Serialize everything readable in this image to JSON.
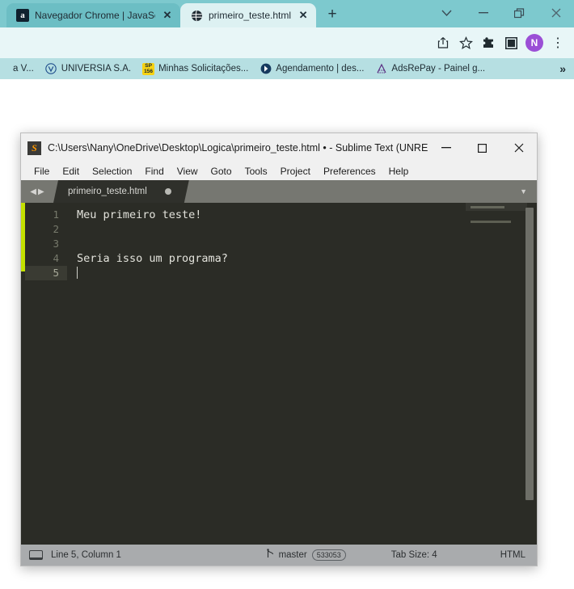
{
  "browser": {
    "tabs": [
      {
        "title": "Navegador Chrome | JavaScr",
        "favicon": "alura-icon",
        "favicon_letter": "a",
        "close": "✕",
        "active": false
      },
      {
        "title": "primeiro_teste.html",
        "favicon": "globe-icon",
        "close": "✕",
        "active": true
      }
    ],
    "new_tab_label": "+",
    "window_controls": {
      "tab_search": "⌄",
      "minimize": "—",
      "restore": "❐",
      "close": "✕"
    },
    "toolbar": {
      "share_icon": "share-icon",
      "bookmark_icon": "star-icon",
      "extensions_icon": "puzzle-icon",
      "side_panel_icon": "side-panel-icon",
      "profile_initial": "N",
      "menu_icon": "⋮"
    },
    "bookmarks": [
      {
        "label": "a V...",
        "icon": "favicon"
      },
      {
        "label": "UNIVERSIA S.A.",
        "icon": "universia-icon",
        "icon_text": "V"
      },
      {
        "label": "Minhas Solicitações...",
        "icon": "sp156-icon",
        "icon_text_top": "SP",
        "icon_text_bottom": "156"
      },
      {
        "label": "Agendamento | des...",
        "icon": "agendamento-icon"
      },
      {
        "label": "AdsRePay - Painel g...",
        "icon": "adsrepay-icon"
      }
    ],
    "bookmarks_overflow": "»"
  },
  "sublime": {
    "window_title": "C:\\Users\\Nany\\OneDrive\\Desktop\\Logica\\primeiro_teste.html • - Sublime Text (UNREGI...",
    "logo_letter": "S",
    "window_controls": {
      "minimize": "—",
      "maximize": "☐",
      "close": "✕"
    },
    "menu": [
      {
        "label": "File"
      },
      {
        "label": "Edit"
      },
      {
        "label": "Selection"
      },
      {
        "label": "Find"
      },
      {
        "label": "View"
      },
      {
        "label": "Goto"
      },
      {
        "label": "Tools"
      },
      {
        "label": "Project"
      },
      {
        "label": "Preferences"
      },
      {
        "label": "Help"
      }
    ],
    "nav_back": "◀",
    "nav_forward": "▶",
    "tab": {
      "label": "primeiro_teste.html",
      "dirty": true
    },
    "tab_menu_icon": "▼",
    "editor": {
      "lines": [
        {
          "number": "1",
          "text": "Meu primeiro teste!"
        },
        {
          "number": "2",
          "text": ""
        },
        {
          "number": "3",
          "text": ""
        },
        {
          "number": "4",
          "text": "Seria isso um programa?"
        },
        {
          "number": "5",
          "text": ""
        }
      ],
      "current_line": "5"
    },
    "status": {
      "position": "Line 5, Column 1",
      "git_branch": "master",
      "git_badge": "533053",
      "tab_size": "Tab Size: 4",
      "syntax": "HTML"
    }
  },
  "colors": {
    "chrome_theme": "#7dc9ce",
    "toolbar": "#e8f6f7",
    "bookmarks_bar": "#b6dfe2",
    "editor_bg": "#2b2c26",
    "modified_strip": "#c3e000",
    "avatar": "#9b4fd6",
    "status_bar": "#a9abad"
  }
}
